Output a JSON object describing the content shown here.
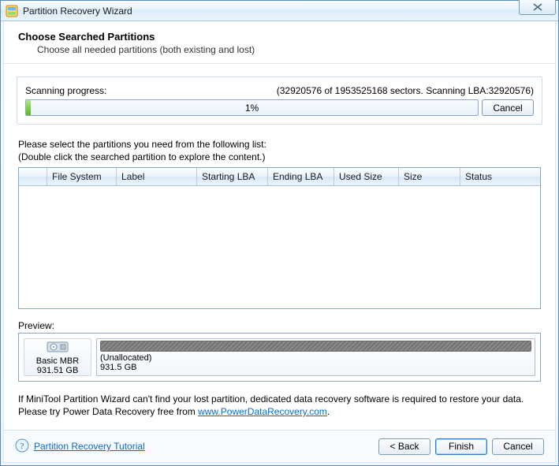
{
  "window": {
    "title": "Partition Recovery Wizard"
  },
  "header": {
    "title": "Choose Searched Partitions",
    "subtitle": "Choose all needed partitions (both existing and lost)"
  },
  "scan": {
    "label": "Scanning progress:",
    "status": "(32920576 of 1953525168 sectors. Scanning LBA:32920576)",
    "percent": "1%",
    "cancel": "Cancel"
  },
  "list_hint_line1": "Please select the partitions you need from the following list:",
  "list_hint_line2": "(Double click the searched partition to explore the content.)",
  "columns": {
    "checkbox": "",
    "filesystem": "File System",
    "label": "Label",
    "starting_lba": "Starting LBA",
    "ending_lba": "Ending LBA",
    "used_size": "Used Size",
    "size": "Size",
    "status": "Status"
  },
  "preview": {
    "label": "Preview:",
    "disk": {
      "name": "Basic MBR",
      "size": "931.51 GB"
    },
    "unalloc": {
      "name": "(Unallocated)",
      "size": "931.5 GB"
    }
  },
  "note": {
    "text1": "If MiniTool Partition Wizard can't find your lost partition, dedicated data recovery software is required to restore your data. Please try Power Data Recovery free from ",
    "link": "www.PowerDataRecovery.com",
    "text2": "."
  },
  "footer": {
    "tutorial": "Partition Recovery Tutorial",
    "back": "< Back",
    "finish": "Finish",
    "cancel": "Cancel"
  }
}
